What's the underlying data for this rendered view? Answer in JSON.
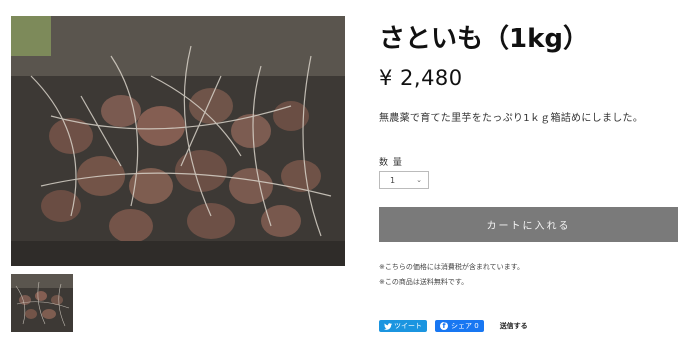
{
  "product": {
    "title": "さといも（1kg）",
    "price": "¥ 2,480",
    "description": "無農薬で育てた里芋をたっぷり1ｋｇ箱詰めにしました。"
  },
  "quantity": {
    "label": "数 量",
    "value": "1"
  },
  "cart": {
    "button_label": "カートに入れる"
  },
  "notes": {
    "tax": "※こちらの価格には消費税が含まれています。",
    "shipping": "※この商品は送料無料です。"
  },
  "share": {
    "tweet_label": "ツイート",
    "facebook_label": "シェア 0",
    "send_label": "送信する"
  },
  "colors": {
    "cart_button": "#7a7a7a",
    "twitter": "#1b95e0",
    "facebook": "#1877f2"
  }
}
